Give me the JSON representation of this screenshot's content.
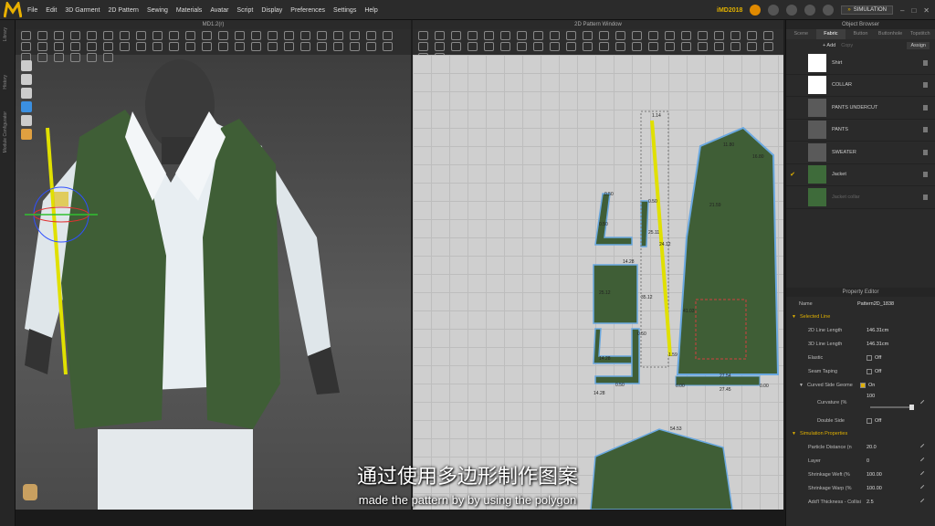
{
  "app": {
    "menu": [
      "File",
      "Edit",
      "3D Garment",
      "2D Pattern",
      "Sewing",
      "Materials",
      "Avatar",
      "Script",
      "Display",
      "Preferences",
      "Settings",
      "Help"
    ],
    "user": "iMD2018",
    "simulation": "SIMULATION"
  },
  "left_strip": [
    "Library",
    "History",
    "Module Configurator"
  ],
  "view3d": {
    "title": "MD1.2(r)"
  },
  "view2d": {
    "title": "2D Pattern Window",
    "labels": [
      "1.14",
      "11.80",
      "16.80",
      "0.50",
      "0.50",
      "21.59",
      "0.50",
      "14.28",
      "25.12",
      "35.12",
      "0.50",
      "14.28",
      "0.50",
      "14.28",
      "41.03",
      "27.54",
      "27.45",
      "0.00",
      "0.00",
      "54.53",
      "1.59",
      "25.11",
      "24.12"
    ]
  },
  "object_browser": {
    "title": "Object Browser",
    "tabs": [
      "Scene",
      "Fabric",
      "Button",
      "Buttonhole",
      "Topstitch"
    ],
    "active_tab": "Fabric",
    "actions": {
      "add": "+ Add",
      "copy": "Copy",
      "assign": "Assign"
    },
    "fabrics": [
      {
        "name": "Shirt",
        "color": "#ffffff",
        "checked": false
      },
      {
        "name": "COLLAR",
        "color": "#ffffff",
        "checked": false
      },
      {
        "name": "PANTS UNDERCUT",
        "color": "#5a5a5a",
        "checked": false
      },
      {
        "name": "PANTS",
        "color": "#5a5a5a",
        "checked": false
      },
      {
        "name": "SWEATER",
        "color": "#5a5a5a",
        "checked": false
      },
      {
        "name": "Jacket",
        "color": "#3e6b3a",
        "checked": true
      },
      {
        "name": "Jacket collar",
        "color": "#3e6b3a",
        "checked": false
      }
    ]
  },
  "property_editor": {
    "title": "Property Editor",
    "name_label": "Name",
    "name_value": "Pattern2D_1838",
    "selected_line": "Selected Line",
    "line_2d_label": "2D Line Length",
    "line_2d_value": "146.31cm",
    "line_3d_label": "3D Line Length",
    "line_3d_value": "146.31cm",
    "elastic_label": "Elastic",
    "elastic_value": "Off",
    "seam_label": "Seam Taping",
    "seam_value": "Off",
    "curved_label": "Curved Side Geome",
    "curved_value": "On",
    "curvature_label": "Curvature (%",
    "curvature_value": "100",
    "double_label": "Double Side",
    "double_value": "Off",
    "sim_props": "Simulation Properties",
    "particle_label": "Particle Distance (n",
    "particle_value": "20.0",
    "layer_label": "Layer",
    "layer_value": "0",
    "weft_label": "Shrinkage Weft (%",
    "weft_value": "100.00",
    "warp_label": "Shrinkage Warp (%",
    "warp_value": "100.00",
    "thick_label": "Add'l Thickness - Collisi",
    "thick_value": "2.5"
  },
  "subtitles": {
    "zh": "通过使用多边形制作图案",
    "en": "made the pattern by by using the polygon"
  }
}
